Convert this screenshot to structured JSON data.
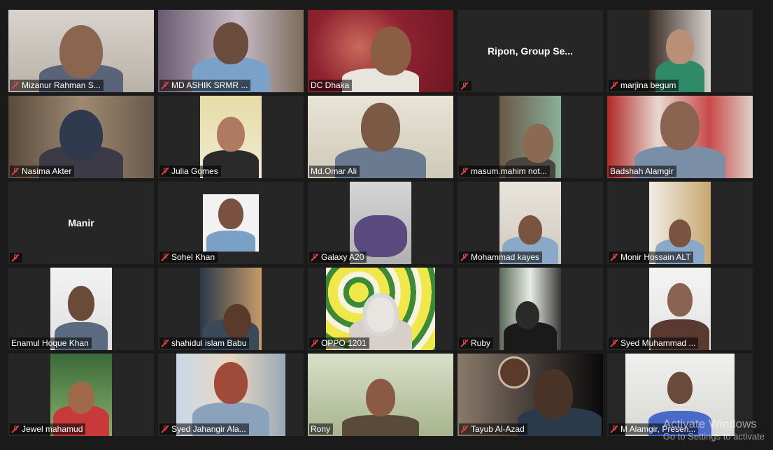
{
  "participants": [
    {
      "name": "Mizanur Rahman S...",
      "muted": true
    },
    {
      "name": "MD ASHIK SRMR ...",
      "muted": true
    },
    {
      "name": "DC Dhaka",
      "muted": false,
      "active": true
    },
    {
      "name": "",
      "display_name": "Ripon, Group Se...",
      "muted": true
    },
    {
      "name": "marjina begum",
      "muted": true
    },
    {
      "name": "Nasima Akter",
      "muted": true
    },
    {
      "name": "Julia Gomes",
      "muted": true
    },
    {
      "name": "Md.Omar Ali",
      "muted": false
    },
    {
      "name": "masum.mahim not...",
      "muted": true
    },
    {
      "name": "Badshah Alamgir",
      "muted": false
    },
    {
      "name": "",
      "display_name": "Manir",
      "muted": true
    },
    {
      "name": "Sohel Khan",
      "muted": true
    },
    {
      "name": "Galaxy A20",
      "muted": true
    },
    {
      "name": "Mohammad kayes",
      "muted": true
    },
    {
      "name": "Monir Hossain ALT",
      "muted": true
    },
    {
      "name": "Enamul Hoque Khan",
      "muted": false
    },
    {
      "name": "shahidul islam Babu",
      "muted": true
    },
    {
      "name": "OPPO 1201",
      "muted": true
    },
    {
      "name": "Ruby",
      "muted": true
    },
    {
      "name": "Syed Muhammad ...",
      "muted": true
    },
    {
      "name": "Jewel mahamud",
      "muted": true
    },
    {
      "name": "Syed Jahangir Ala...",
      "muted": true
    },
    {
      "name": "Rony",
      "muted": false
    },
    {
      "name": "Tayub Al-Azad",
      "muted": true
    },
    {
      "name": "M Alamgir, Presen...",
      "muted": true
    }
  ],
  "watermark": {
    "line1": "Activate Windows",
    "line2": "Go to Settings to activate"
  },
  "colors": {
    "background": "#1a1a1a",
    "tile": "#262626",
    "active_border": "#e8e27a",
    "muted_icon": "#e04040"
  }
}
